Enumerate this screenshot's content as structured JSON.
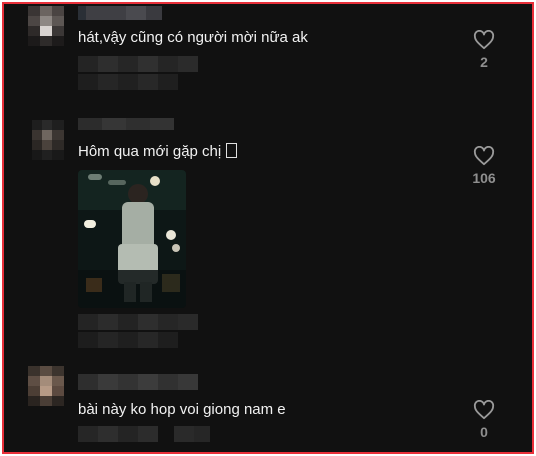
{
  "comments": [
    {
      "text": "hát,vậy cũng có người mời nữa ak",
      "likes": "2"
    },
    {
      "text": "Hôm qua mới gặp chị ",
      "likes": "106"
    },
    {
      "text": "bài này ko hop voi giong nam e",
      "likes": "0"
    }
  ],
  "icons": {
    "like": "heart-outline-icon"
  },
  "colors": {
    "border": "#e8303a",
    "background": "#111111",
    "text": "#f2f2f2",
    "muted": "#8f8f8f"
  }
}
